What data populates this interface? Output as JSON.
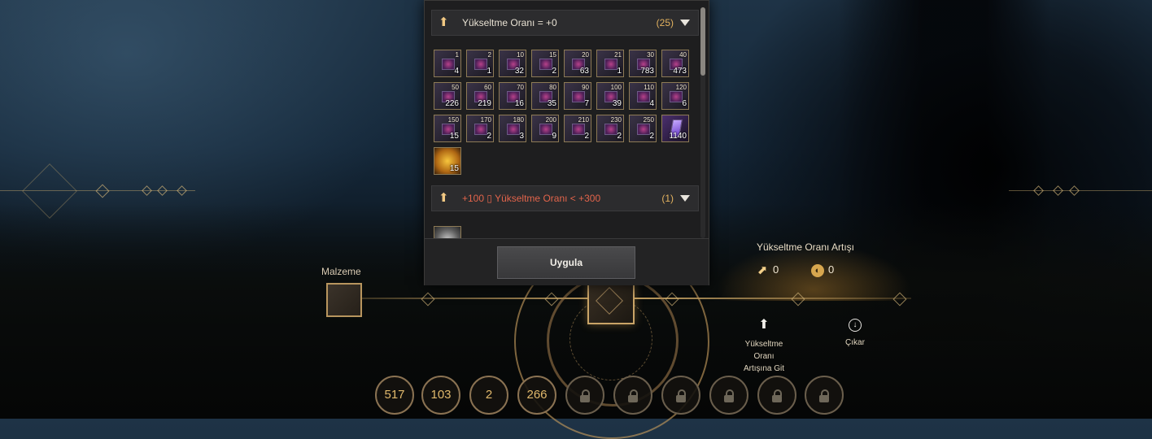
{
  "panel": {
    "sections": [
      {
        "icon": "upgrade-arrow-icon",
        "title": "Yükseltme Oranı = +0",
        "title_style": "normal",
        "count": "(25)"
      },
      {
        "icon": "upgrade-arrow-icon",
        "title": "+100 ▯ Yükseltme Oranı < +300",
        "title_style": "red",
        "count": "(1)"
      }
    ],
    "items": [
      {
        "top": "1",
        "qty": "4",
        "kind": "tome"
      },
      {
        "top": "2",
        "qty": "1",
        "kind": "tome"
      },
      {
        "top": "10",
        "qty": "32",
        "kind": "tome"
      },
      {
        "top": "15",
        "qty": "2",
        "kind": "tome"
      },
      {
        "top": "20",
        "qty": "63",
        "kind": "tome"
      },
      {
        "top": "21",
        "qty": "1",
        "kind": "tome"
      },
      {
        "top": "30",
        "qty": "783",
        "kind": "tome"
      },
      {
        "top": "40",
        "qty": "473",
        "kind": "tome"
      },
      {
        "top": "50",
        "qty": "226",
        "kind": "tome"
      },
      {
        "top": "60",
        "qty": "219",
        "kind": "tome"
      },
      {
        "top": "70",
        "qty": "16",
        "kind": "tome"
      },
      {
        "top": "80",
        "qty": "35",
        "kind": "tome"
      },
      {
        "top": "90",
        "qty": "7",
        "kind": "tome"
      },
      {
        "top": "100",
        "qty": "39",
        "kind": "tome"
      },
      {
        "top": "110",
        "qty": "4",
        "kind": "tome"
      },
      {
        "top": "120",
        "qty": "6",
        "kind": "tome"
      },
      {
        "top": "150",
        "qty": "15",
        "kind": "tome"
      },
      {
        "top": "170",
        "qty": "2",
        "kind": "tome"
      },
      {
        "top": "180",
        "qty": "3",
        "kind": "tome"
      },
      {
        "top": "200",
        "qty": "9",
        "kind": "tome"
      },
      {
        "top": "210",
        "qty": "2",
        "kind": "tome"
      },
      {
        "top": "230",
        "qty": "2",
        "kind": "tome"
      },
      {
        "top": "250",
        "qty": "2",
        "kind": "tome"
      },
      {
        "top": "",
        "qty": "1140",
        "kind": "crystal"
      },
      {
        "top": "",
        "qty": "15",
        "kind": "orb"
      }
    ],
    "section2_items": [
      {
        "top": "",
        "qty": "",
        "kind": "silver"
      }
    ],
    "apply_label": "Uygula"
  },
  "material": {
    "label": "Malzeme"
  },
  "boost": {
    "title": "Yükseltme Oranı Artışı",
    "values": [
      "0",
      "0"
    ]
  },
  "actions": {
    "goto_label": "Yükseltme\nOranı\nArtışına Git",
    "remove_label": "Çıkar"
  },
  "bottom_circles": [
    "517",
    "103",
    "2",
    "266"
  ],
  "locked_slots": 6,
  "colors": {
    "accent_gold": "#c9a467",
    "count_orange": "#e3b25f",
    "red_text": "#e2644b"
  }
}
